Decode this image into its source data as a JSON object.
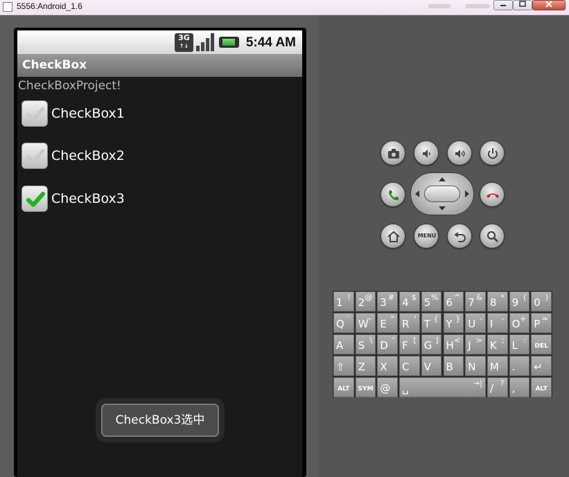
{
  "window": {
    "title": "5556:Android_1.6"
  },
  "status_bar": {
    "network": "3G",
    "network_sub": "↑↓",
    "time": "5:44 AM"
  },
  "app": {
    "title": "CheckBox",
    "hello_text": "CheckBoxProject!",
    "checkboxes": [
      {
        "label": "CheckBox1",
        "checked": false
      },
      {
        "label": "CheckBox2",
        "checked": false
      },
      {
        "label": "CheckBox3",
        "checked": true
      }
    ],
    "toast": "CheckBox3选中"
  },
  "hardware": {
    "menu_label": "MENU"
  },
  "keyboard": {
    "rows": [
      [
        {
          "k": "1",
          "a": "!"
        },
        {
          "k": "2",
          "a": "@"
        },
        {
          "k": "3",
          "a": "#"
        },
        {
          "k": "4",
          "a": "$"
        },
        {
          "k": "5",
          "a": "%"
        },
        {
          "k": "6",
          "a": "^"
        },
        {
          "k": "7",
          "a": "&"
        },
        {
          "k": "8",
          "a": "*"
        },
        {
          "k": "9",
          "a": "("
        },
        {
          "k": "0",
          "a": ")"
        }
      ],
      [
        {
          "k": "Q",
          "a": "`"
        },
        {
          "k": "W",
          "a": "~"
        },
        {
          "k": "E",
          "a": "\""
        },
        {
          "k": "R",
          "a": "'"
        },
        {
          "k": "T",
          "a": "{"
        },
        {
          "k": "Y",
          "a": "}"
        },
        {
          "k": "U",
          "a": "-"
        },
        {
          "k": "I",
          "a": "-"
        },
        {
          "k": "O",
          "a": "+"
        },
        {
          "k": "P",
          "a": "="
        }
      ],
      [
        {
          "k": "A",
          "a": ""
        },
        {
          "k": "S",
          "a": "\\"
        },
        {
          "k": "D",
          "a": "'"
        },
        {
          "k": "F",
          "a": "["
        },
        {
          "k": "G",
          "a": "]"
        },
        {
          "k": "H",
          "a": "<"
        },
        {
          "k": "J",
          "a": ">"
        },
        {
          "k": "K",
          "a": ";"
        },
        {
          "k": "L",
          "a": ":"
        },
        {
          "k": "DEL",
          "a": ""
        }
      ],
      [
        {
          "k": "⇧",
          "a": ""
        },
        {
          "k": "Z",
          "a": ""
        },
        {
          "k": "X",
          "a": ""
        },
        {
          "k": "C",
          "a": ""
        },
        {
          "k": "V",
          "a": ""
        },
        {
          "k": "B",
          "a": ""
        },
        {
          "k": "N",
          "a": ""
        },
        {
          "k": "M",
          "a": ""
        },
        {
          "k": ".",
          "a": ""
        },
        {
          "k": "↵",
          "a": ""
        }
      ],
      [
        {
          "k": "ALT",
          "a": ""
        },
        {
          "k": "SYM",
          "a": ""
        },
        {
          "k": "@",
          "a": ""
        },
        {
          "k": "␣",
          "a": "→|"
        },
        {
          "k": "/",
          "a": "?"
        },
        {
          "k": ",",
          "a": ""
        },
        {
          "k": "ALT",
          "a": ""
        }
      ]
    ]
  }
}
